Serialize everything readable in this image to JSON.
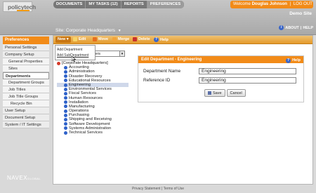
{
  "app": {
    "logo": "policytech"
  },
  "topnav": [
    {
      "label": "DOCUMENTS"
    },
    {
      "label": "MY TASKS (12)"
    },
    {
      "label": "REPORTS"
    },
    {
      "label": "PREFERENCES"
    }
  ],
  "user": {
    "welcome": "Welcome",
    "name": "Douglas Johnson",
    "sep": "|",
    "logout": "LOG OUT",
    "site": "Demo Site"
  },
  "site": {
    "label": "Site:",
    "value": "Corporate Headquarters"
  },
  "help_links": {
    "about": "ABOUT",
    "sep": "|",
    "help": "HELP",
    "info": "i"
  },
  "leftnav": {
    "head": "Preferences",
    "items": [
      {
        "label": "Personal Settings",
        "level": "top"
      },
      {
        "label": "Company Setup",
        "level": "top"
      },
      {
        "label": "General Properties",
        "level": "sub"
      },
      {
        "label": "Sites",
        "level": "sub"
      },
      {
        "label": "Departments",
        "level": "active"
      },
      {
        "label": "Department Groups",
        "level": "sub"
      },
      {
        "label": "Job Titles",
        "level": "sub"
      },
      {
        "label": "Job Title Groups",
        "level": "sub"
      },
      {
        "label": "Recycle Bin",
        "level": "sub2"
      },
      {
        "label": "User Setup",
        "level": "top"
      },
      {
        "label": "Document Setup",
        "level": "top"
      },
      {
        "label": "System / IT Settings",
        "level": "top"
      }
    ]
  },
  "brand": {
    "navex": "NAVEX",
    "global": "GLOBAL"
  },
  "toolbar": {
    "new": "New",
    "edit": "Edit",
    "move": "Move",
    "merge": "Merge",
    "delete": "Delete",
    "help": "Help"
  },
  "dropdown": {
    "items": [
      "Add Department",
      "Add SubDepartment"
    ]
  },
  "site_select": {
    "value": "arters"
  },
  "tree": {
    "root": "[Corporate Headquarters]",
    "children": [
      "Accounting",
      "Administration",
      "Disaster Recovery",
      "Educational Resources",
      "Engineering",
      "Environmental Services",
      "Fiscal Services",
      "Human Resources",
      "Installation",
      "Manufacturing",
      "Operations",
      "Purchasing",
      "Shipping and Receiving",
      "Software Development",
      "Systems Administration",
      "Technical Services"
    ],
    "selected": "Engineering"
  },
  "edit_panel": {
    "title": "Edit Department - Engineering",
    "help": "Help",
    "fields": [
      {
        "label": "Department Name",
        "value": "Engineering"
      },
      {
        "label": "Reference ID",
        "value": "Engineering"
      }
    ],
    "save": "Save",
    "cancel": "Cancel"
  },
  "footer": {
    "privacy": "Privacy Statement",
    "sep": "|",
    "terms": "Terms of Use"
  },
  "colors": {
    "accent": "#f28b18",
    "header": "#b3b3b3",
    "selected_row": "#cfd8ea",
    "tree_icon": "#2f62c9"
  }
}
